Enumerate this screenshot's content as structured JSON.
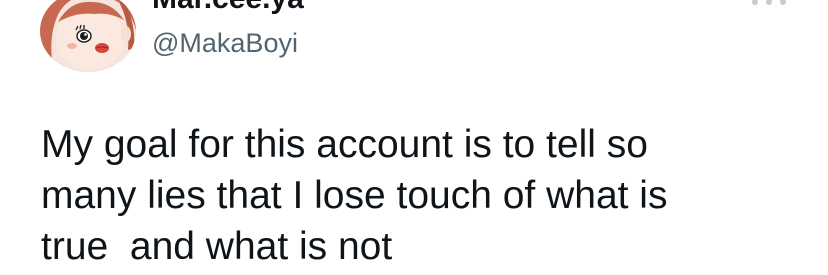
{
  "tweet": {
    "author": {
      "display_name": "Mar.cee.ya",
      "handle": "@MakaBoyi",
      "avatar_icon": "cartoon-girl-avatar-icon"
    },
    "more_icon": "more-options-icon",
    "text_lines": [
      "My goal for this account is to tell so",
      "many lies that I lose touch of what is",
      "true  and what is not"
    ]
  },
  "colors": {
    "text": "#0f1419",
    "secondary": "#536471",
    "background": "#ffffff"
  }
}
